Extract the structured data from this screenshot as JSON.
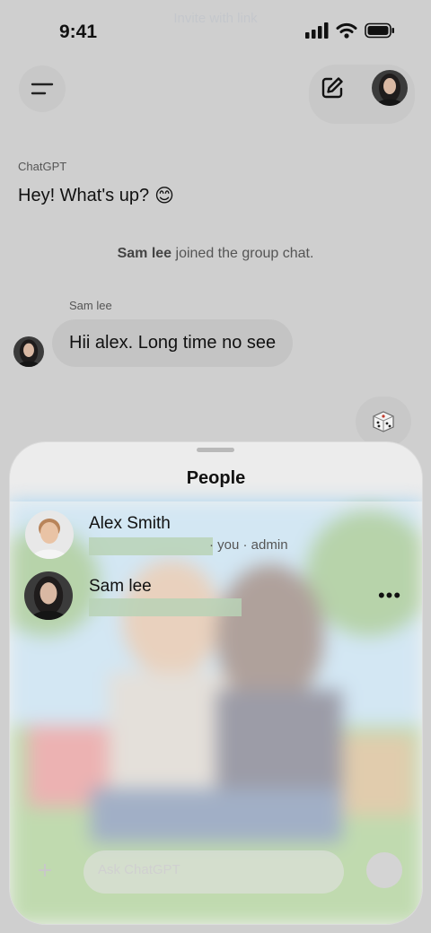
{
  "status_bar": {
    "time": "9:41"
  },
  "header": {
    "ghost_label": "Invite with link"
  },
  "chat": {
    "assistant_name": "ChatGPT",
    "assistant_message": "Hey! What's up?",
    "assistant_emoji": "😊",
    "system_user": "Sam lee",
    "system_text": " joined the group chat.",
    "sam_name": "Sam lee",
    "sam_message": "Hii alex. Long time no see"
  },
  "people_sheet": {
    "title": "People",
    "members": [
      {
        "name": "Alex Smith",
        "sub": "· you · admin"
      },
      {
        "name": "Sam lee",
        "more": "•••"
      }
    ]
  },
  "composer": {
    "placeholder": "Ask ChatGPT"
  },
  "icons": [
    "menu-icon",
    "edit-icon",
    "dice-icon",
    "signal-icon",
    "wifi-icon",
    "battery-icon",
    "more-icon"
  ]
}
